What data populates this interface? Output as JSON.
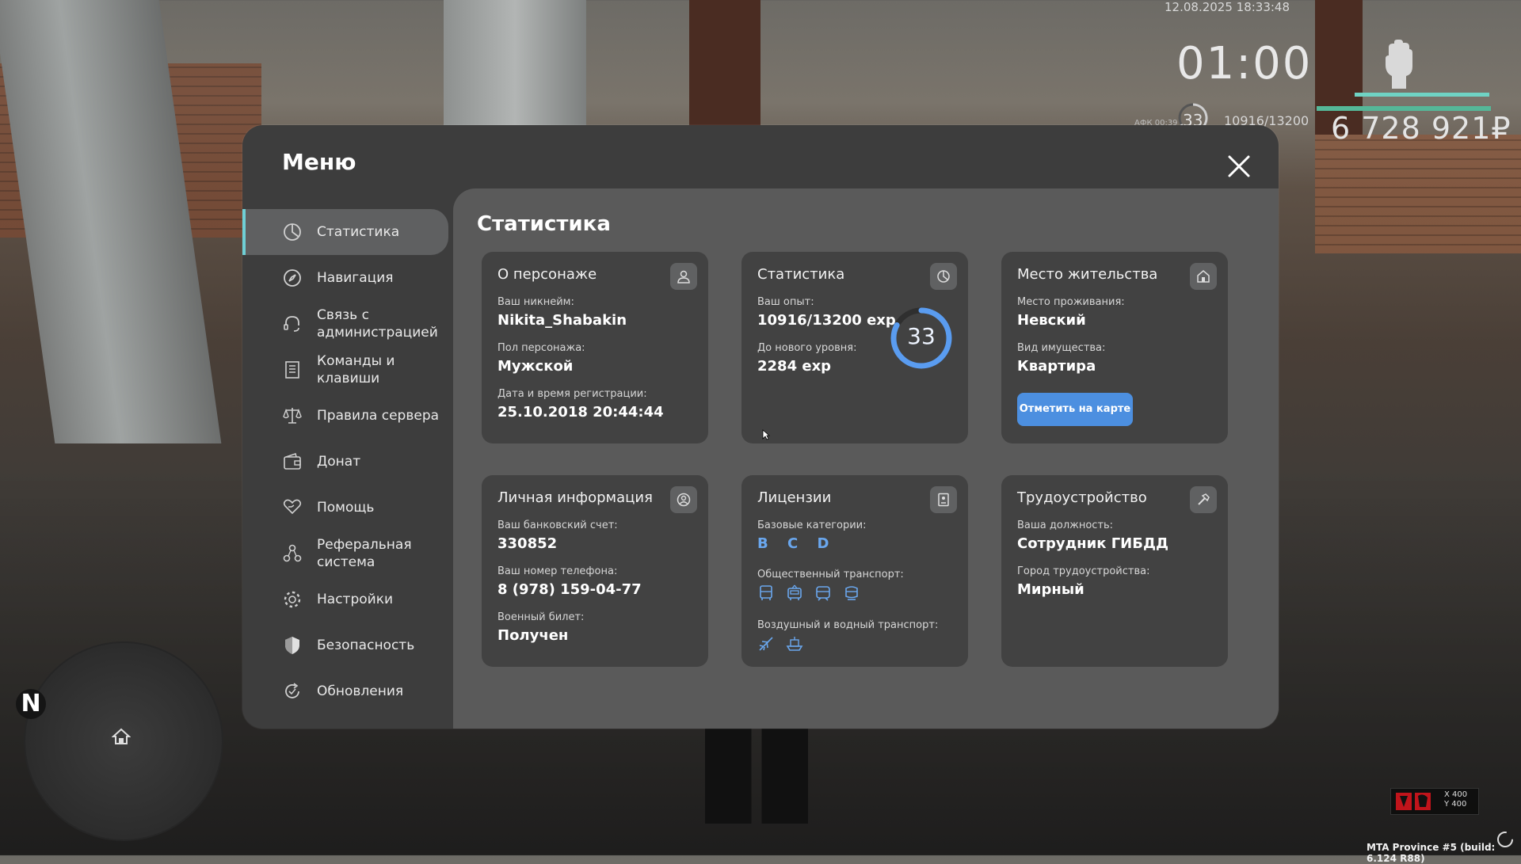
{
  "hud": {
    "datetime": "12.08.2025 18:33:48",
    "clock": "01:00",
    "money": "6 728 921₽",
    "afk": "АФК 00:39",
    "level": "33",
    "exp": "10916/13200",
    "radar_north": "N",
    "coords_x": "X 400",
    "coords_y": "Y 400",
    "build": "MTA Province #5 (build: 6.124 R88)"
  },
  "menu": {
    "title": "Меню",
    "sidebar": [
      {
        "label": "Статистика",
        "icon": "statistics-icon",
        "active": true
      },
      {
        "label": "Навигация",
        "icon": "compass-icon"
      },
      {
        "label": "Связь с администрацией",
        "icon": "headset-icon"
      },
      {
        "label": "Команды и клавиши",
        "icon": "list-icon"
      },
      {
        "label": "Правила сервера",
        "icon": "scales-icon"
      },
      {
        "label": "Донат",
        "icon": "wallet-icon"
      },
      {
        "label": "Помощь",
        "icon": "heart-hand-icon"
      },
      {
        "label": "Реферальная система",
        "icon": "referral-icon"
      },
      {
        "label": "Настройки",
        "icon": "gear-icon"
      },
      {
        "label": "Безопасность",
        "icon": "shield-icon"
      },
      {
        "label": "Обновления",
        "icon": "refresh-icon"
      }
    ]
  },
  "content": {
    "title": "Статистика",
    "character": {
      "title": "О персонаже",
      "nick_label": "Ваш никнейм:",
      "nick": "Nikita_Shabakin",
      "gender_label": "Пол персонажа:",
      "gender": "Мужской",
      "reg_label": "Дата и время регистрации:",
      "reg": "25.10.2018 20:44:44"
    },
    "stats": {
      "title": "Статистика",
      "exp_label": "Ваш опыт:",
      "exp": "10916/13200 exp",
      "next_label": "До нового уровня:",
      "next": "2284 exp",
      "level": "33",
      "progress": 0.827
    },
    "residence": {
      "title": "Место жительства",
      "place_label": "Место проживания:",
      "place": "Невский",
      "property_label": "Вид имущества:",
      "property": "Квартира",
      "button": "Отметить на карте"
    },
    "personal": {
      "title": "Личная информация",
      "bank_label": "Ваш банковский счет:",
      "bank": "330852",
      "phone_label": "Ваш номер телефона:",
      "phone": "8 (978) 159-04-77",
      "military_label": "Военный билет:",
      "military": "Получен"
    },
    "licenses": {
      "title": "Лицензии",
      "base_label": "Базовые категории:",
      "base": "B C D",
      "public_label": "Общественный транспорт:",
      "public_icons": [
        "bus-icon",
        "trolleybus-icon",
        "tram-icon",
        "train-icon"
      ],
      "air_label": "Воздушный и водный транспорт:",
      "air_icons": [
        "plane-icon",
        "boat-icon"
      ]
    },
    "job": {
      "title": "Трудоустройство",
      "position_label": "Ваша должность:",
      "position": "Сотрудник ГИБДД",
      "city_label": "Город трудоустройства:",
      "city": "Мирный"
    }
  },
  "colors": {
    "accent": "#4c8fe0",
    "category_blue": "#6aa7ee",
    "active_bar": "#6fd0d6",
    "ring": "#5a9cf0"
  }
}
